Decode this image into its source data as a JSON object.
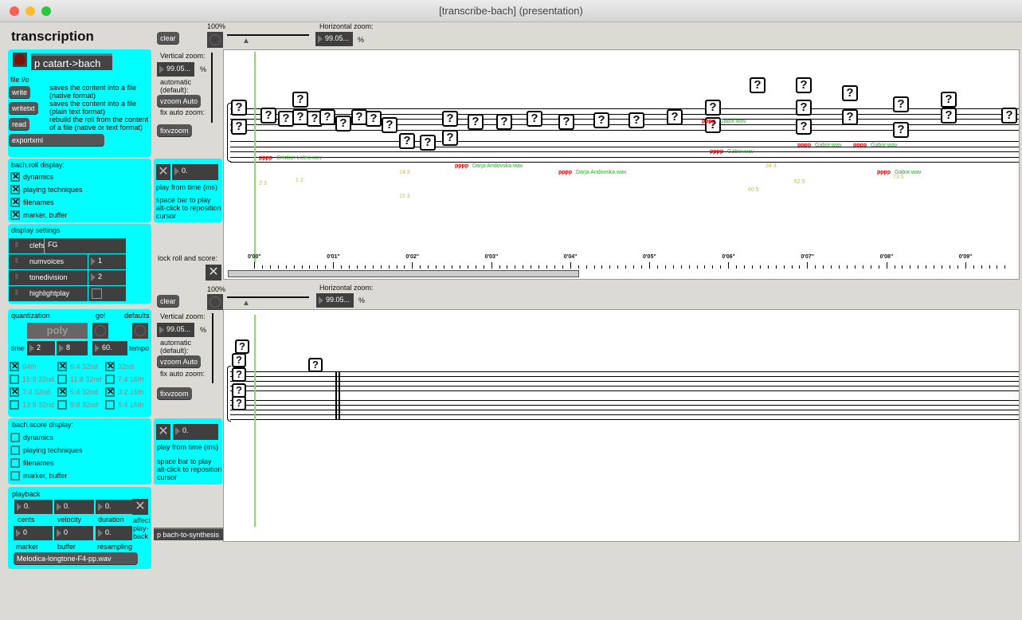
{
  "window": {
    "title": "[transcribe-bach] (presentation)"
  },
  "title": "transcription",
  "fileio": {
    "patcher": "p catart->bach",
    "label": "file i/o",
    "write": "write",
    "write_desc": "saves the content into a file (native format)",
    "writetxt": "writetxt",
    "writetxt_desc": "saves the content into a file (plain text format)",
    "read": "read",
    "read_desc": "rebuild the roll from the content of a file (native or text format)",
    "exportxml": "exportxml"
  },
  "roll_display": {
    "title": "bach.roll display:",
    "items": [
      {
        "label": "dynamics",
        "checked": true
      },
      {
        "label": "playing techniques",
        "checked": true
      },
      {
        "label": "filenames",
        "checked": true
      },
      {
        "label": "marker, buffer",
        "checked": true
      }
    ]
  },
  "display_settings": {
    "title": "display settings",
    "clefs_label": "clefs",
    "clefs_value": "FG",
    "numvoices_label": "numvoices",
    "numvoices_value": "1",
    "tonedivision_label": "tonedivision",
    "tonedivision_value": "2",
    "highlightplay_label": "highlightplay",
    "highlightplay_checked": false
  },
  "quantization": {
    "title": "quantization",
    "go": "go!",
    "defaults": "defaults",
    "poly": "poly",
    "time_label": "time",
    "time_num": "2",
    "time_den": "8",
    "tempo_value": "60.",
    "tempo_label": "tempo",
    "divisions": [
      {
        "label": "64th",
        "checked": true
      },
      {
        "label": "6:4 32nd",
        "checked": true
      },
      {
        "label": "32nd",
        "checked": true
      },
      {
        "label": "15:8 32nd",
        "checked": false
      },
      {
        "label": "11:8 32nd",
        "checked": false
      },
      {
        "label": "7:4 16th",
        "checked": false
      },
      {
        "label": "7:4 32nd",
        "checked": true
      },
      {
        "label": "5:4 32nd",
        "checked": true
      },
      {
        "label": "3:2 16th",
        "checked": true
      },
      {
        "label": "13:8 32nd",
        "checked": false
      },
      {
        "label": "9:8 32nd",
        "checked": false
      },
      {
        "label": "5:4 16th",
        "checked": false
      }
    ]
  },
  "score_display": {
    "title": "bach.score display:",
    "items": [
      {
        "label": "dynamics",
        "checked": false
      },
      {
        "label": "playing techniques",
        "checked": false
      },
      {
        "label": "filenames",
        "checked": false
      },
      {
        "label": "marker, buffer",
        "checked": false
      }
    ]
  },
  "playback": {
    "title": "playback",
    "cents": "0.",
    "cents_label": "cents",
    "velocity": "0.",
    "velocity_label": "velocity",
    "duration": "0.",
    "duration_label": "duration",
    "affect_label": "affect play-back",
    "marker": "0",
    "marker_label": "marker",
    "buffer": "0",
    "buffer_label": "buffer",
    "resampling": "0.",
    "resampling_label": "resampling",
    "file": "Melodica-longtone-F4-pp.wav"
  },
  "roll_controls": {
    "clear": "clear",
    "zoom100": "100%",
    "hzoom_label": "Horizontal zoom:",
    "hzoom_value": "99.05...",
    "percent": "%",
    "vzoom_label": "Vertical zoom:",
    "vzoom_value": "99.05...",
    "auto_label": "automatic (default):",
    "vzoom_auto": "vzoom Auto",
    "fix_label": "fix auto zoom:",
    "fixvzoom": "fixvzoom",
    "play_time": "0.",
    "play_label": "play from time (ms)",
    "help": "space bar to play alt-click to reposition cursor",
    "lock_label": "lock roll and score:",
    "lock_checked": true
  },
  "score_controls": {
    "clear": "clear",
    "zoom100": "100%",
    "hzoom_label": "Horizontal zoom:",
    "hzoom_value": "99.05...",
    "percent": "%",
    "vzoom_label": "Vertical zoom:",
    "vzoom_value": "99.05...",
    "auto_label": "automatic (default):",
    "vzoom_auto": "vzoom Auto",
    "fix_label": "fix auto zoom:",
    "fixvzoom": "fixvzoom",
    "play_time": "0.",
    "play_label": "play from time (ms)",
    "help": "space bar to play alt-click to reposition cursor",
    "synth": "p bach-to-synthesis"
  },
  "roll": {
    "time_ticks": [
      "0'00\"",
      "0'01\"",
      "0'02\"",
      "0'03\"",
      "0'04\"",
      "0'05\"",
      "0'06\"",
      "0'07\"",
      "0'08\"",
      "0'09\""
    ],
    "labels": [
      {
        "dyn": "pppp",
        "file": "Cristian Lolea.wav"
      },
      {
        "dyn": "pppp",
        "file": "Darja Andovska.wav"
      },
      {
        "dyn": "pppp",
        "file": "Darja Andovska.wav"
      },
      {
        "dyn": "pppp",
        "file": "Gabor.wav"
      },
      {
        "dyn": "pppp",
        "file": "Gabor.wav"
      },
      {
        "dyn": "pppp",
        "file": "Gabor.wav"
      },
      {
        "dyn": "pppp",
        "file": "Gabor.wav"
      },
      {
        "dyn": "pppp",
        "file": "Gabor.wav"
      }
    ],
    "marker_labels": [
      "2 3",
      "1 2",
      "14 3",
      "15 3",
      "34 3",
      "60 5",
      "62 5",
      "73 5"
    ]
  },
  "colors": {
    "panel": "#00ffff",
    "dynamics": "#cc0000",
    "filename": "#22aa22",
    "marker": "#ddbb00",
    "cursor": "#88dd66"
  }
}
